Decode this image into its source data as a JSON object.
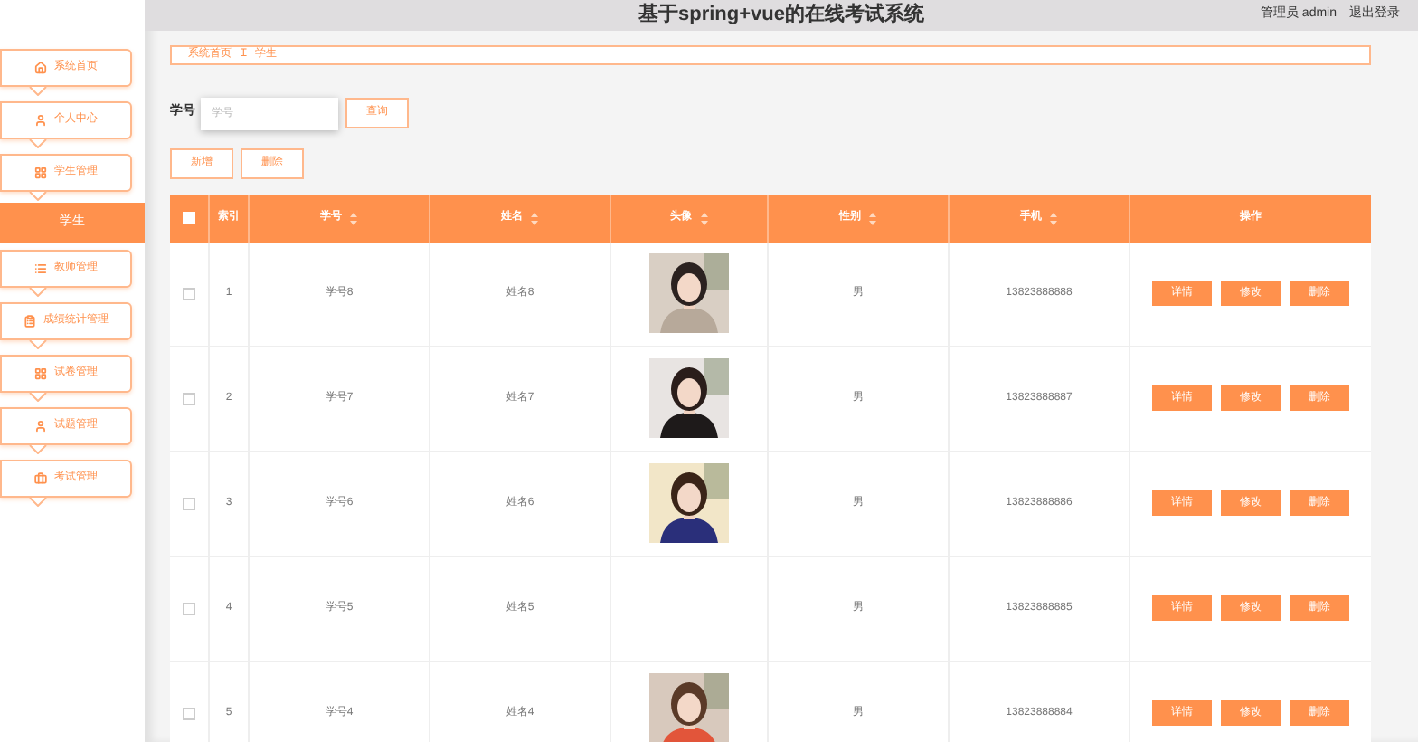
{
  "header": {
    "title": "基于spring+vue的在线考试系统",
    "user": "管理员 admin",
    "logout": "退出登录"
  },
  "sidebar": {
    "items": [
      {
        "label": "系统首页"
      },
      {
        "label": "个人中心"
      },
      {
        "label": "学生管理",
        "children": [
          {
            "label": "学生",
            "selected": true
          }
        ]
      },
      {
        "label": "教师管理"
      },
      {
        "label": "成绩统计管理"
      },
      {
        "label": "试卷管理"
      },
      {
        "label": "试题管理"
      },
      {
        "label": "考试管理"
      }
    ]
  },
  "breadcrumb": {
    "items": [
      "系统首页",
      "学生"
    ],
    "separator": "Ɪ"
  },
  "search": {
    "label": "学号",
    "placeholder": "学号",
    "button": "查询"
  },
  "actions": [
    "新增",
    "删除"
  ],
  "table": {
    "all_checked": false,
    "columns": [
      {
        "label": "索引",
        "sortable": false
      },
      {
        "label": "学号",
        "sortable": true
      },
      {
        "label": "姓名",
        "sortable": true
      },
      {
        "label": "头像",
        "sortable": true
      },
      {
        "label": "性别",
        "sortable": true
      },
      {
        "label": "手机",
        "sortable": true
      },
      {
        "label": "操作",
        "sortable": false
      }
    ],
    "rows": [
      {
        "checked": false,
        "index": "1",
        "id": "学号8",
        "name": "姓名8",
        "gender": "男",
        "phone": "13823888888",
        "actions": [
          "详情",
          "修改",
          "删除"
        ]
      },
      {
        "checked": false,
        "index": "2",
        "id": "学号7",
        "name": "姓名7",
        "gender": "男",
        "phone": "13823888887",
        "actions": [
          "详情",
          "修改",
          "删除"
        ]
      },
      {
        "checked": false,
        "index": "3",
        "id": "学号6",
        "name": "姓名6",
        "gender": "男",
        "phone": "13823888886",
        "actions": [
          "详情",
          "修改",
          "删除"
        ]
      },
      {
        "checked": false,
        "index": "4",
        "id": "学号5",
        "name": "姓名5",
        "gender": "男",
        "phone": "13823888885",
        "actions": [
          "详情",
          "修改",
          "删除"
        ]
      },
      {
        "checked": false,
        "index": "5",
        "id": "学号4",
        "name": "姓名4",
        "gender": "男",
        "phone": "13823888884",
        "actions": [
          "详情",
          "修改",
          "删除"
        ]
      }
    ]
  }
}
